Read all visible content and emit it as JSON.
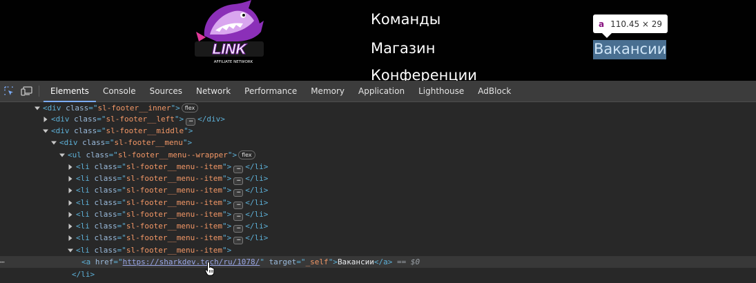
{
  "site": {
    "logo_text": "LINK",
    "logo_subtext": "AFFILIATE NETWORK",
    "menu": [
      "Команды",
      "Магазин",
      "Конференции",
      "Вакансии"
    ],
    "menu_partial": "ы",
    "tooltip": {
      "tag": "a",
      "size": "110.45 × 29"
    },
    "brand_colors": {
      "logo_purple": "#8b2fb8",
      "logo_magenta": "#e0399a",
      "highlight": "#6fa8dc"
    }
  },
  "devtools": {
    "icons": [
      "inspect-element-icon",
      "device-toolbar-icon"
    ],
    "tabs": [
      "Elements",
      "Console",
      "Sources",
      "Network",
      "Performance",
      "Memory",
      "Application",
      "Lighthouse",
      "AdBlock"
    ],
    "active_tab": "Elements",
    "accent": "#7cacf8"
  },
  "tree": {
    "rows": [
      {
        "open": "<div",
        "attr": "class",
        "val": "sl-footer__inner",
        "close": ">",
        "badge": "flex"
      },
      {
        "open": "<div",
        "attr": "class",
        "val": "sl-footer__left",
        "close": ">",
        "end": "</div>"
      },
      {
        "open": "<div",
        "attr": "class",
        "val": "sl-footer__middle",
        "close": ">"
      },
      {
        "open": "<div",
        "attr": "class",
        "val": "sl-footer__menu",
        "close": ">"
      },
      {
        "open": "<ul",
        "attr": "class",
        "val": "sl-footer__menu--wrapper",
        "close": ">",
        "badge": "flex"
      },
      {
        "open": "<li",
        "attr": "class",
        "val": "sl-footer__menu--item",
        "close": ">",
        "end": "</li>"
      },
      {
        "open": "<li",
        "attr": "class",
        "val": "sl-footer__menu--item",
        "close": ">",
        "end": "</li>"
      },
      {
        "open": "<li",
        "attr": "class",
        "val": "sl-footer__menu--item",
        "close": ">",
        "end": "</li>"
      },
      {
        "open": "<li",
        "attr": "class",
        "val": "sl-footer__menu--item",
        "close": ">",
        "end": "</li>"
      },
      {
        "open": "<li",
        "attr": "class",
        "val": "sl-footer__menu--item",
        "close": ">",
        "end": "</li>"
      },
      {
        "open": "<li",
        "attr": "class",
        "val": "sl-footer__menu--item",
        "close": ">",
        "end": "</li>"
      },
      {
        "open": "<li",
        "attr": "class",
        "val": "sl-footer__menu--item",
        "close": ">",
        "end": "</li>"
      },
      {
        "open": "<li",
        "attr": "class",
        "val": "sl-footer__menu--item",
        "close": ">"
      }
    ],
    "selected": {
      "dots": "⋯",
      "open": "<a",
      "href_attr": "href",
      "href": "https://sharkdev.tech/ru/1078/",
      "target_attr": "target",
      "target": "_self",
      "text": "Вакансии",
      "close": "</a>",
      "marker": "== $0"
    },
    "last": "</li>"
  }
}
